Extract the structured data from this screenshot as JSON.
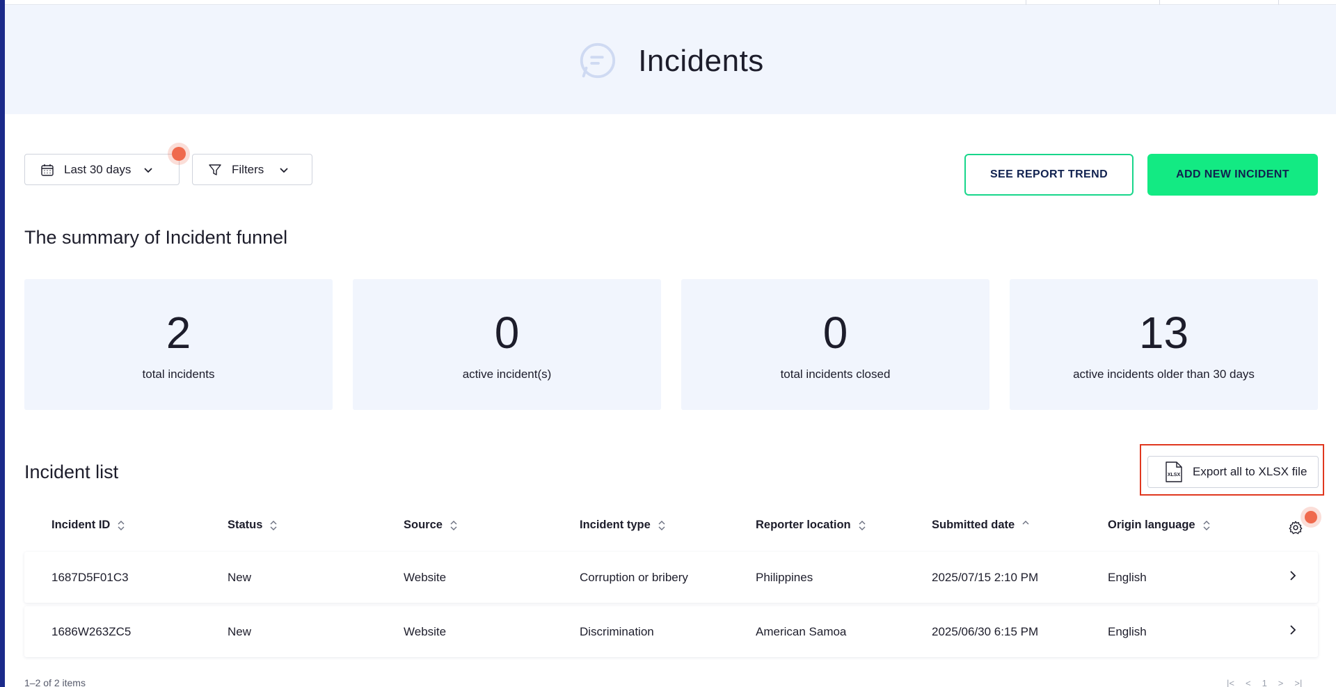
{
  "header": {
    "title": "Incidents",
    "logo_icon": "chat-bubble-logo"
  },
  "toolbar": {
    "date_range": "Last 30 days",
    "filters_label": "Filters"
  },
  "actions": {
    "trend_label": "SEE REPORT TREND",
    "add_label": "ADD NEW INCIDENT"
  },
  "summary": {
    "title": "The summary of Incident funnel",
    "cards": [
      {
        "value": "2",
        "label": "total incidents"
      },
      {
        "value": "0",
        "label": "active incident(s)"
      },
      {
        "value": "0",
        "label": "total incidents closed"
      },
      {
        "value": "13",
        "label": "active incidents older than 30 days"
      }
    ]
  },
  "list": {
    "title": "Incident list",
    "export_label": "Export all to XLSX file",
    "export_icon_text": "XLSX",
    "columns": [
      "Incident ID",
      "Status",
      "Source",
      "Incident type",
      "Reporter location",
      "Submitted date",
      "Origin language"
    ],
    "rows": [
      [
        "1687D5F01C3",
        "New",
        "Website",
        "Corruption or bribery",
        "Philippines",
        "2025/07/15 2:10 PM",
        "English"
      ],
      [
        "1686W263ZC5",
        "New",
        "Website",
        "Discrimination",
        "American Samoa",
        "2025/06/30 6:15 PM",
        "English"
      ]
    ],
    "footer": "1–2 of 2 items",
    "pager": {
      "first": "|<",
      "prev": "<",
      "page": "1",
      "next": ">",
      "last": ">|"
    }
  },
  "colors": {
    "accent": "#13ea83",
    "accent_border": "#17d68a",
    "navy": "#10214f",
    "panel": "#f1f5fd",
    "highlight": "#e0371f",
    "marker": "#ef6a4d"
  }
}
